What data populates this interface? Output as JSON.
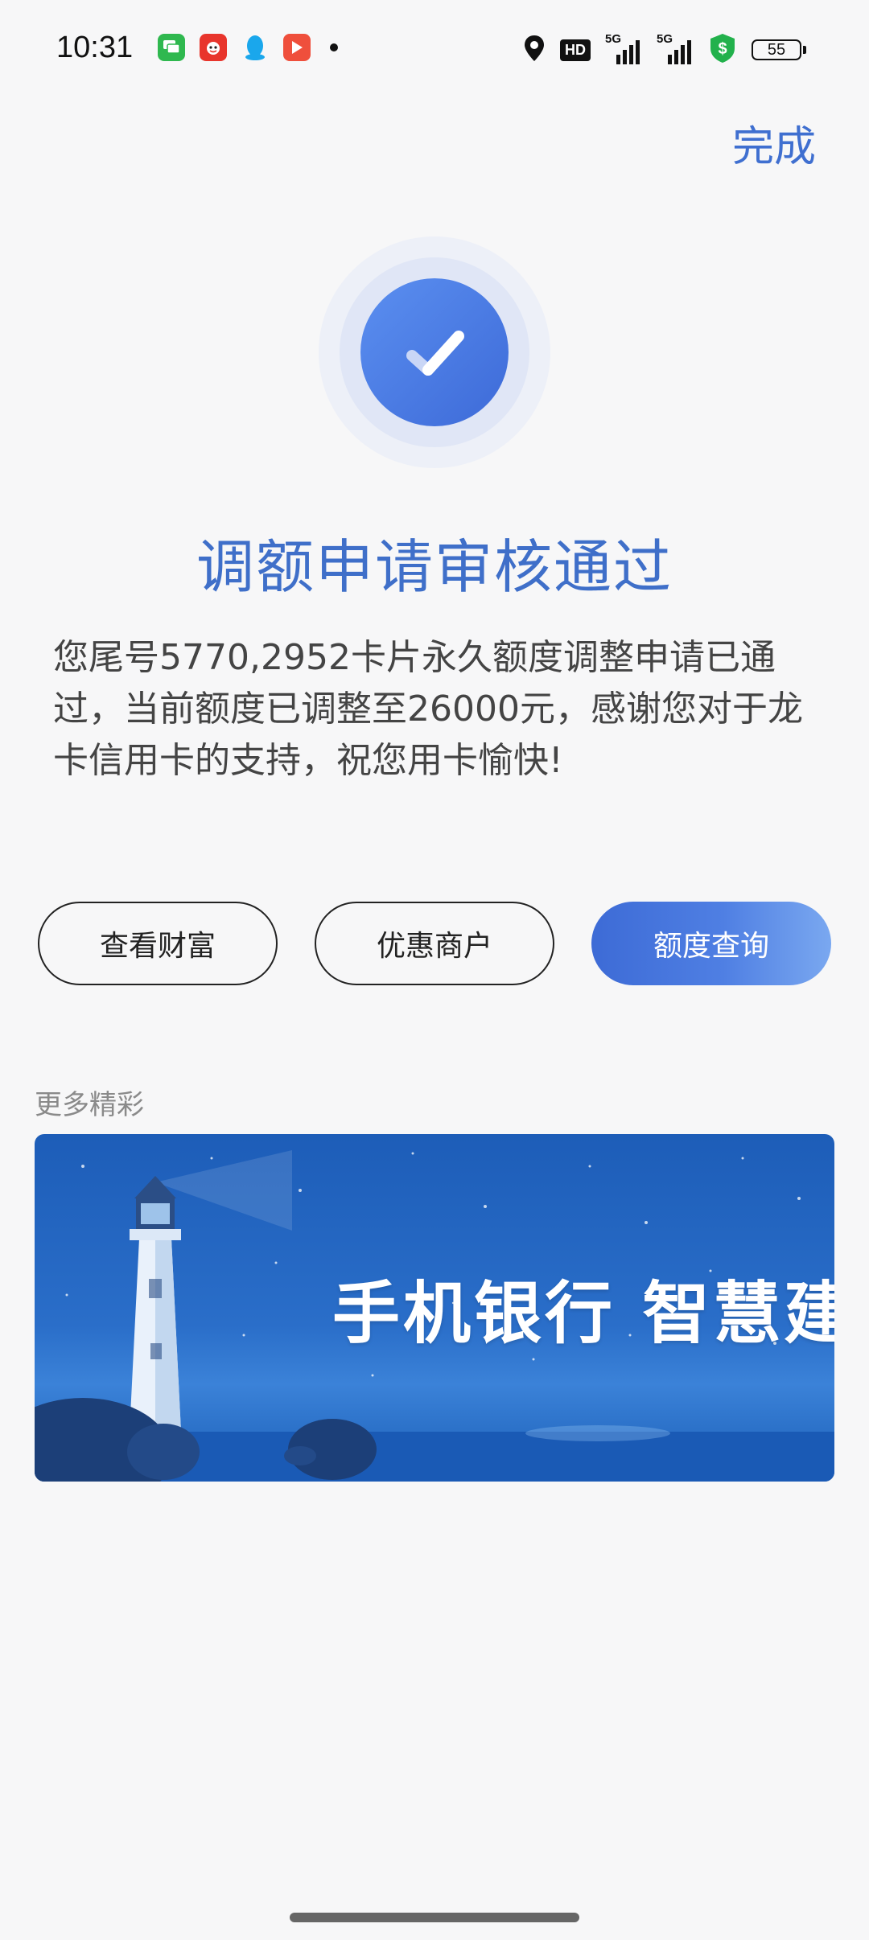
{
  "status_bar": {
    "time": "10:31",
    "hd_label": "HD",
    "network_1": "5G",
    "network_2": "5G",
    "battery": "55"
  },
  "header": {
    "done_label": "完成"
  },
  "result": {
    "title": "调额申请审核通过",
    "message": "您尾号5770,2952卡片永久额度调整申请已通过，当前额度已调整至26000元，感谢您对于龙卡信用卡的支持，祝您用卡愉快!"
  },
  "actions": [
    {
      "label": "查看财富"
    },
    {
      "label": "优惠商户"
    },
    {
      "label": "额度查询"
    }
  ],
  "more": {
    "title": "更多精彩",
    "banner_text": "手机银行  智慧建行"
  },
  "colors": {
    "accent": "#3f6fd0",
    "primary_button_start": "#3d6bd6",
    "primary_button_end": "#7aa8f0",
    "background": "#f7f7f8"
  }
}
